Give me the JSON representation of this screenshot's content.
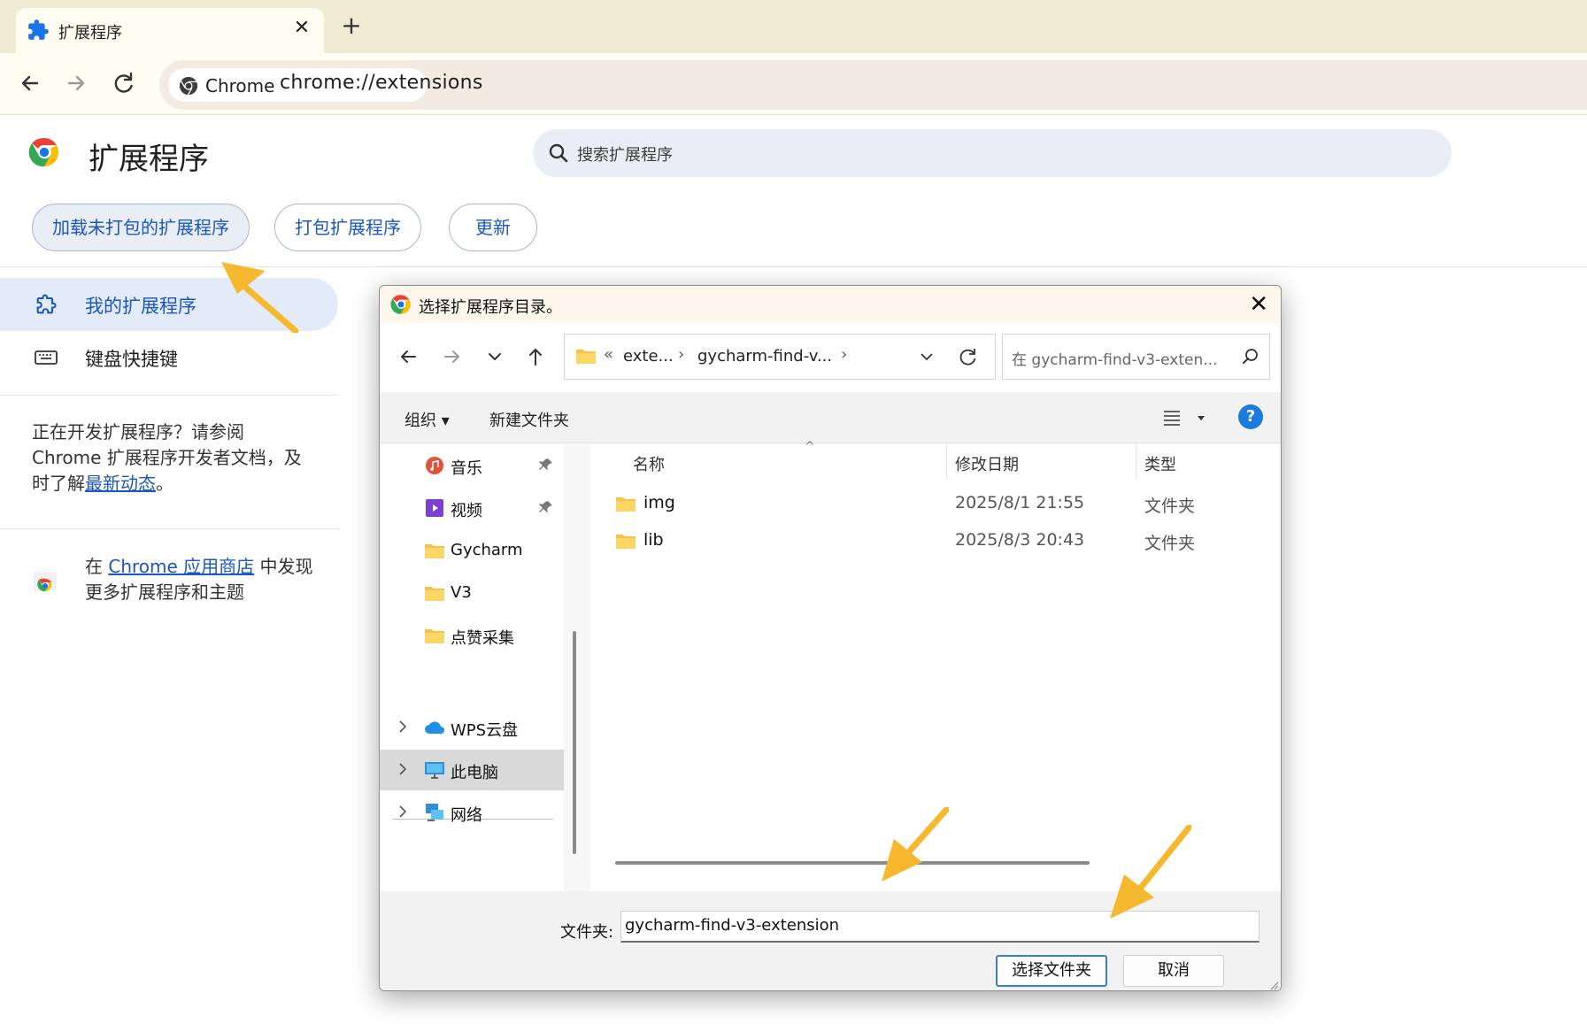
{
  "browser": {
    "tab_title": "扩展程序",
    "tab_close": "✕",
    "new_tab": "+",
    "chip_label": "Chrome",
    "url": "chrome://extensions"
  },
  "page": {
    "title": "扩展程序",
    "search_placeholder": "搜索扩展程序",
    "buttons": {
      "load_unpacked": "加载未打包的扩展程序",
      "pack": "打包扩展程序",
      "update": "更新"
    },
    "sidebar": {
      "my_extensions": "我的扩展程序",
      "shortcuts": "键盘快捷键"
    },
    "dev_note": {
      "text1": "正在开发扩展程序？请参阅 Chrome 扩展程序开发者文档，及时了解",
      "link": "最新动态",
      "text2": "。"
    },
    "store_note": {
      "prefix": "在 ",
      "link": "Chrome 应用商店",
      "suffix": " 中发现更多扩展程序和主题"
    }
  },
  "dialog": {
    "title": "选择扩展程序目录。",
    "close": "✕",
    "breadcrumb": {
      "overflow": "«",
      "part1": "exte...",
      "part2": "gycharm-find-v...",
      "sep": "›"
    },
    "search_placeholder": "在 gycharm-find-v3-exten...",
    "commands": {
      "organize": "组织 ▾",
      "new_folder": "新建文件夹",
      "help": "?"
    },
    "nav": [
      {
        "label": "音乐",
        "icon": "music-icon",
        "pinned": true
      },
      {
        "label": "视频",
        "icon": "video-icon",
        "pinned": true
      },
      {
        "label": "Gycharm",
        "icon": "folder-icon",
        "pinned": false
      },
      {
        "label": "V3",
        "icon": "folder-icon",
        "pinned": false
      },
      {
        "label": "点赞采集",
        "icon": "folder-icon",
        "pinned": false
      },
      {
        "label": "WPS云盘",
        "icon": "cloud-icon",
        "pinned": false
      },
      {
        "label": "此电脑",
        "icon": "computer-icon",
        "pinned": false
      },
      {
        "label": "网络",
        "icon": "network-icon",
        "pinned": false
      }
    ],
    "columns": {
      "name": "名称",
      "date": "修改日期",
      "type": "类型"
    },
    "files": [
      {
        "name": "img",
        "date": "2025/8/1 21:55",
        "type": "文件夹"
      },
      {
        "name": "lib",
        "date": "2025/8/3 20:43",
        "type": "文件夹"
      }
    ],
    "folder_label": "文件夹:",
    "folder_value": "gycharm-find-v3-extension",
    "select_button": "选择文件夹",
    "cancel_button": "取消"
  },
  "colors": {
    "accent_blue": "#1a56c4",
    "annotation_arrow": "#f5b82e",
    "tabstrip": "#f1ead3"
  }
}
